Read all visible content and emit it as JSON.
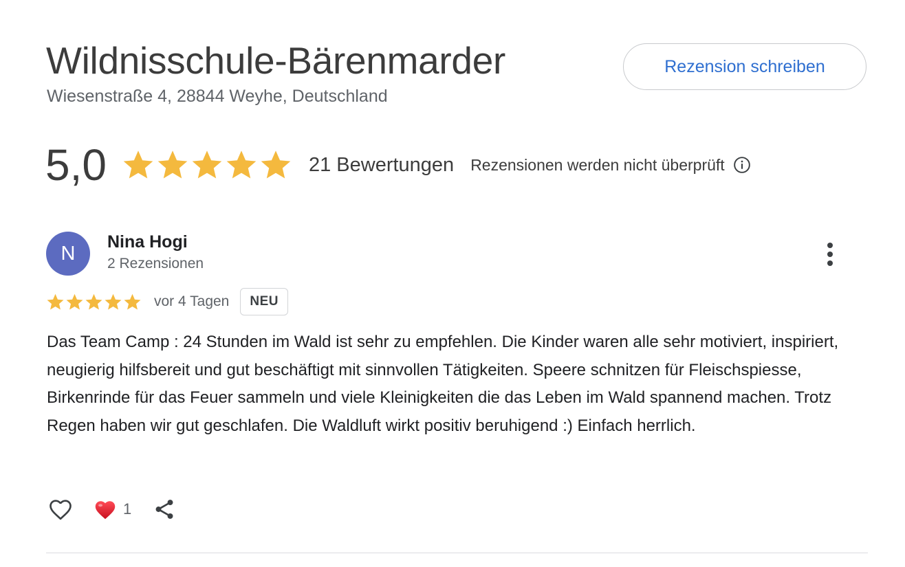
{
  "place": {
    "title": "Wildnisschule-Bärenmarder",
    "address": "Wiesenstraße 4, 28844 Weyhe, Deutschland",
    "write_review_label": "Rezension schreiben"
  },
  "summary": {
    "rating": "5,0",
    "stars": 5,
    "count_label": "21 Bewertungen",
    "not_verified_label": "Rezensionen werden nicht überprüft"
  },
  "review": {
    "avatar_initial": "N",
    "avatar_color": "#5c6bc0",
    "author": "Nina Hogi",
    "author_meta": "2 Rezensionen",
    "stars": 5,
    "date": "vor 4 Tagen",
    "badge": "NEU",
    "text": "Das Team Camp : 24 Stunden im Wald ist sehr zu empfehlen. Die Kinder waren alle sehr motiviert, inspiriert, neugierig hilfsbereit und gut beschäftigt mit sinnvollen Tätigkeiten. Speere schnitzen für Fleischspiesse, Birkenrinde für das Feuer sammeln und viele Kleinigkeiten die das Leben im Wald spannend machen. Trotz Regen haben wir gut geschlafen. Die Waldluft wirkt positiv beruhigend :) Einfach herrlich.",
    "reaction_count": "1"
  },
  "colors": {
    "star": "#f4b93e",
    "link": "#2f6fd0",
    "heart": "#e0212e"
  },
  "icons": {
    "info": "info-icon",
    "more": "more-vert-icon",
    "like": "heart-outline-icon",
    "reaction": "red-heart-icon",
    "share": "share-icon"
  }
}
